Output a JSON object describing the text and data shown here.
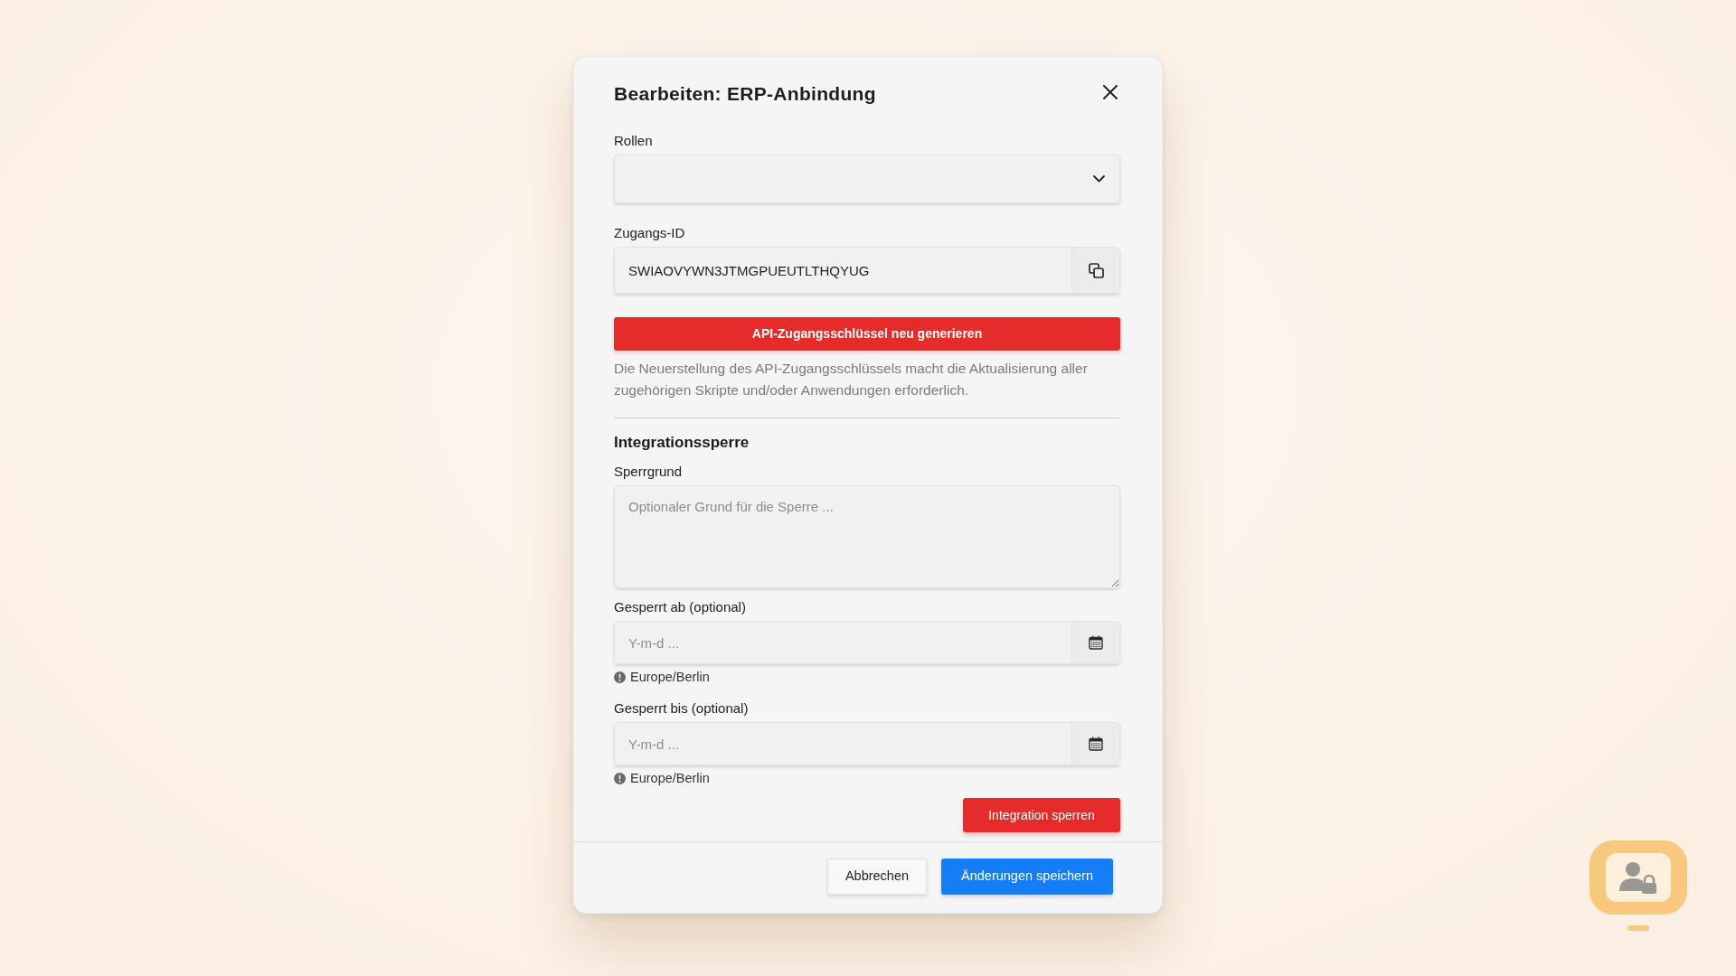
{
  "dialog": {
    "title": "Bearbeiten: ERP-Anbindung"
  },
  "roles": {
    "label": "Rollen"
  },
  "access_id": {
    "label": "Zugangs-ID",
    "value": "SWIAOVYWN3JTMGPUEUTLTHQYUG"
  },
  "regenerate": {
    "button": "API-Zugangsschlüssel neu generieren",
    "help": "Die Neuerstellung des API-Zugangsschlüssels macht die Aktualisierung aller zugehörigen Skripte und/oder Anwendungen erforderlich."
  },
  "lock": {
    "heading": "Integrationssperre",
    "reason": {
      "label": "Sperrgrund",
      "placeholder": "Optionaler Grund für die Sperre ..."
    },
    "dates": [
      {
        "label": "Gesperrt ab (optional)",
        "placeholder": "Y-m-d ...",
        "timezone": "Europe/Berlin"
      },
      {
        "label": "Gesperrt bis (optional)",
        "placeholder": "Y-m-d ...",
        "timezone": "Europe/Berlin"
      }
    ],
    "button": "Integration sperren"
  },
  "footer": {
    "buttons": [
      {
        "label": "Abbrechen",
        "kind": "secondary"
      },
      {
        "label": "Änderungen speichern",
        "kind": "primary"
      }
    ]
  }
}
